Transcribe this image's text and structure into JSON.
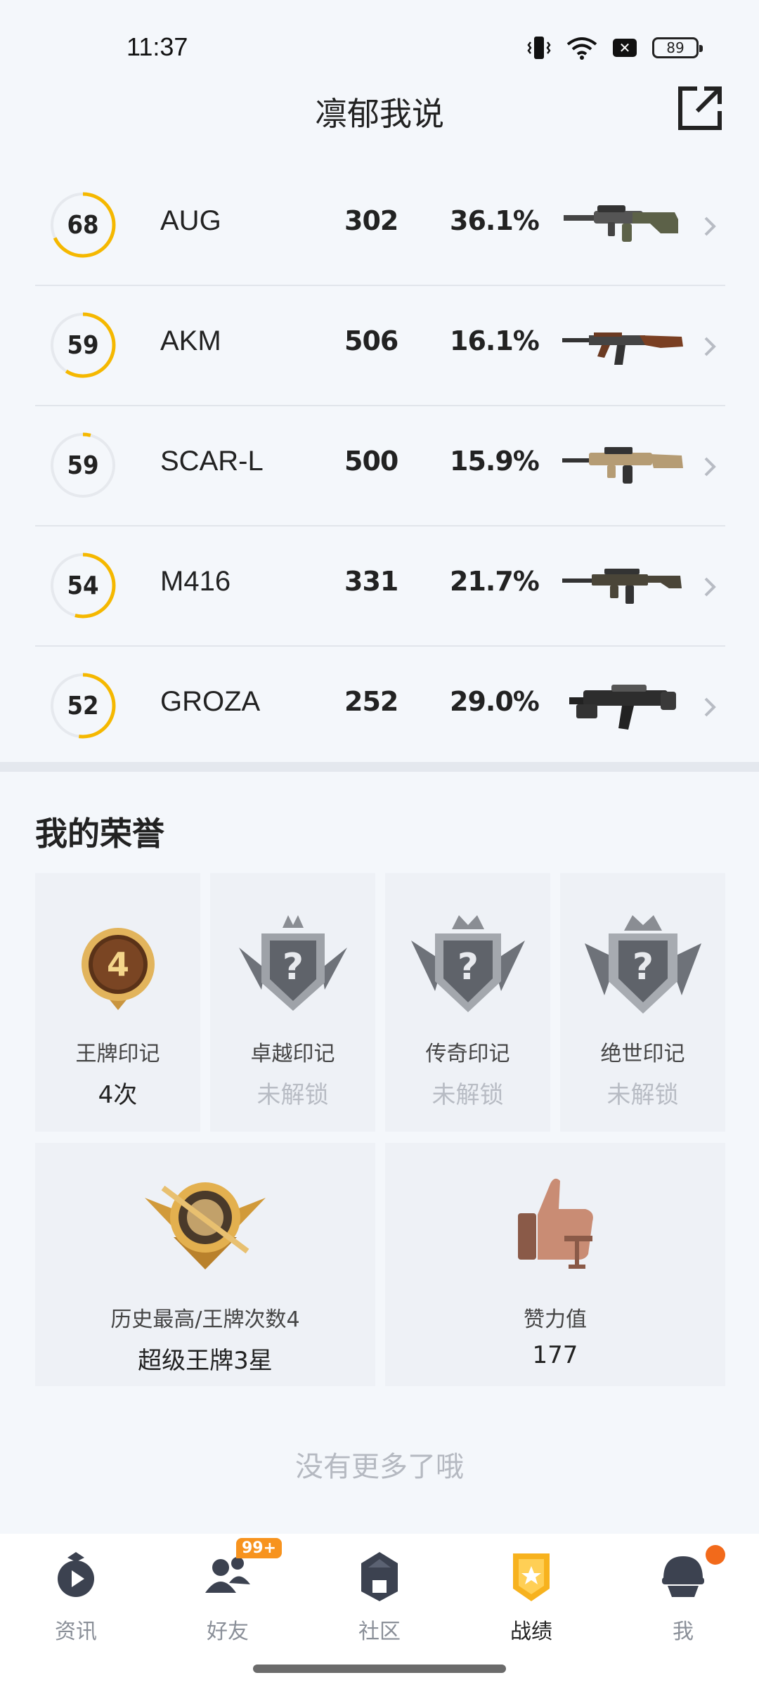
{
  "status_bar": {
    "time": "11:37",
    "battery": "89"
  },
  "header": {
    "title": "凛郁我说"
  },
  "weapons": [
    {
      "score": "68",
      "name": "AUG",
      "kills": "302",
      "pct": "36.1%",
      "ring_fraction": 0.68
    },
    {
      "score": "59",
      "name": "AKM",
      "kills": "506",
      "pct": "16.1%",
      "ring_fraction": 0.59
    },
    {
      "score": "59",
      "name": "SCAR-L",
      "kills": "500",
      "pct": "15.9%",
      "ring_fraction": 0.04
    },
    {
      "score": "54",
      "name": "M416",
      "kills": "331",
      "pct": "21.7%",
      "ring_fraction": 0.54
    },
    {
      "score": "52",
      "name": "GROZA",
      "kills": "252",
      "pct": "29.0%",
      "ring_fraction": 0.52
    }
  ],
  "honors": {
    "title": "我的荣誉",
    "cards": [
      {
        "label": "王牌印记",
        "value": "4次",
        "badge_number": "4",
        "locked": false
      },
      {
        "label": "卓越印记",
        "value": "未解锁",
        "badge_number": "?",
        "locked": true
      },
      {
        "label": "传奇印记",
        "value": "未解锁",
        "badge_number": "?",
        "locked": true
      },
      {
        "label": "绝世印记",
        "value": "未解锁",
        "badge_number": "?",
        "locked": true
      }
    ],
    "wide_cards": [
      {
        "label": "历史最高/王牌次数4",
        "value": "超级王牌3星"
      },
      {
        "label": "赞力值",
        "value": "177"
      }
    ]
  },
  "footer": {
    "no_more": "没有更多了哦"
  },
  "nav": {
    "items": [
      {
        "label": "资讯",
        "icon": "news-icon"
      },
      {
        "label": "好友",
        "icon": "friends-icon",
        "badge": "99+"
      },
      {
        "label": "社区",
        "icon": "community-icon"
      },
      {
        "label": "战绩",
        "icon": "record-icon",
        "active": true
      },
      {
        "label": "我",
        "icon": "profile-icon"
      }
    ]
  },
  "colors": {
    "ring": "#f5b800",
    "ring_track": "#e6e9ee",
    "accent": "#f7931e"
  }
}
